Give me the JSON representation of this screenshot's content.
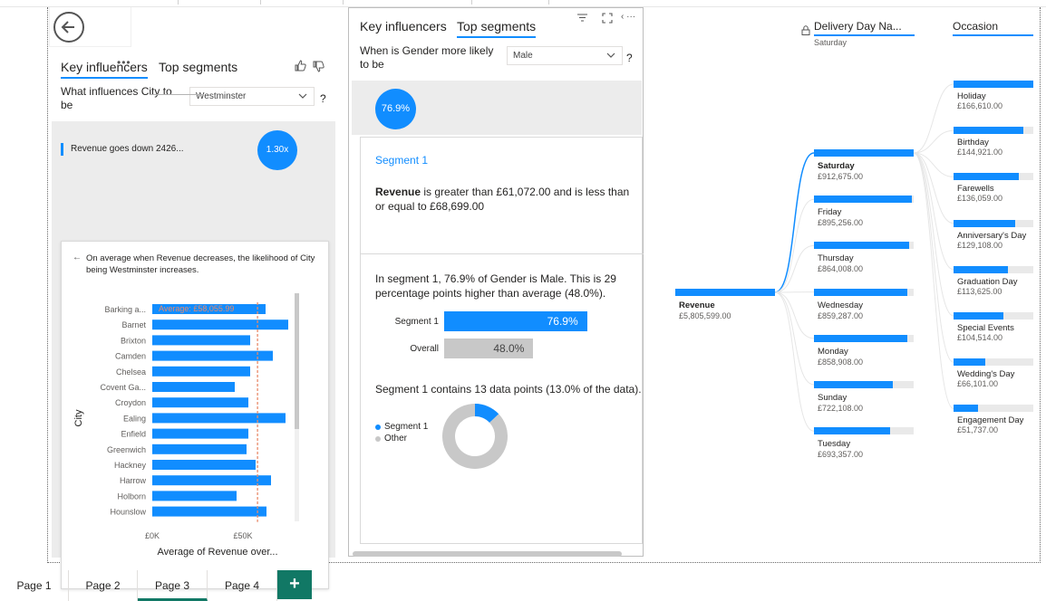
{
  "visual1": {
    "tabs": [
      "Key influencers",
      "Top segments"
    ],
    "question": "What influences City to be",
    "dropdown_value": "Westminster",
    "qmark": "?",
    "influencer_text": "Revenue goes down 2426...",
    "influencer_factor": "1.30x",
    "detail_text": "On average when Revenue decreases, the likelihood of City being Westminster increases.",
    "chart_data": {
      "type": "bar",
      "orientation": "horizontal",
      "categories": [
        "Barking a...",
        "Barnet",
        "Brixton",
        "Camden",
        "Chelsea",
        "Covent Ga...",
        "Croydon",
        "Ealing",
        "Enfield",
        "Greenwich",
        "Hackney",
        "Harrow",
        "Holborn",
        "Hounslow"
      ],
      "values": [
        62500,
        75000,
        54000,
        66500,
        54000,
        45500,
        53000,
        73500,
        53000,
        52000,
        57000,
        65500,
        46500,
        63000
      ],
      "average": 58055.99,
      "average_label": "Average: £58,055.99",
      "xlabel": "Average of Revenue over...",
      "ylabel": "City",
      "xticks": [
        "£0K",
        "£50K"
      ],
      "xtick_values": [
        0,
        50000
      ],
      "xlim": [
        0,
        90000
      ],
      "colors": {
        "bar": "#118dff",
        "average": "#e8896a"
      }
    }
  },
  "visual2": {
    "tabs": [
      "Key influencers",
      "Top segments"
    ],
    "question": "When is Gender more likely to be",
    "dropdown_value": "Male",
    "qmark": "?",
    "segment_bubble": "76.9%",
    "segment_title": "Segment 1",
    "segment_desc_bold": "Revenue",
    "segment_desc_rest": " is greater than £61,072.00 and is less than or equal to £68,699.00",
    "segment_stat": "In segment 1, 76.9% of Gender is Male. This is 29 percentage points higher than average (48.0%).",
    "compare_chart": {
      "type": "bar",
      "categories": [
        "Segment 1",
        "Overall"
      ],
      "values": [
        76.9,
        48.0
      ],
      "labels": [
        "76.9%",
        "48.0%"
      ],
      "colors": [
        "#118dff",
        "#c8c8c8"
      ]
    },
    "datapoints_text": "Segment 1 contains 13 data points (13.0% of the data).",
    "donut_chart": {
      "type": "pie",
      "categories": [
        "Segment 1",
        "Other"
      ],
      "values": [
        13.0,
        87.0
      ],
      "colors": [
        "#118dff",
        "#c8c8c8"
      ]
    }
  },
  "decomp_tree": {
    "headers": {
      "delivery_day": "Delivery Day Na...",
      "delivery_day_sub": "Saturday",
      "occasion": "Occasion"
    },
    "root": {
      "label": "Revenue",
      "value": "£5,805,599.00",
      "share": 1.0
    },
    "days": [
      {
        "label": "Saturday",
        "value": "£912,675.00",
        "share": 1.0,
        "selected": true
      },
      {
        "label": "Friday",
        "value": "£895,256.00",
        "share": 0.98
      },
      {
        "label": "Thursday",
        "value": "£864,008.00",
        "share": 0.95
      },
      {
        "label": "Wednesday",
        "value": "£859,287.00",
        "share": 0.94
      },
      {
        "label": "Monday",
        "value": "£858,908.00",
        "share": 0.94
      },
      {
        "label": "Sunday",
        "value": "£722,108.00",
        "share": 0.79
      },
      {
        "label": "Tuesday",
        "value": "£693,357.00",
        "share": 0.76
      }
    ],
    "occasions": [
      {
        "label": "Holiday",
        "value": "£166,610.00",
        "share": 1.0
      },
      {
        "label": "Birthday",
        "value": "£144,921.00",
        "share": 0.87
      },
      {
        "label": "Farewells",
        "value": "£136,059.00",
        "share": 0.82
      },
      {
        "label": "Anniversary's Day",
        "value": "£129,108.00",
        "share": 0.77
      },
      {
        "label": "Graduation Day",
        "value": "£113,625.00",
        "share": 0.68
      },
      {
        "label": "Special Events",
        "value": "£104,514.00",
        "share": 0.63
      },
      {
        "label": "Wedding's Day",
        "value": "£66,101.00",
        "share": 0.4
      },
      {
        "label": "Engagement Day",
        "value": "£51,737.00",
        "share": 0.31
      }
    ],
    "colors": {
      "bar": "#118dff",
      "track": "#e9e9e9"
    }
  },
  "page_tabs": [
    "Page 1",
    "Page 2",
    "Page 3",
    "Page 4"
  ],
  "active_page": "Page 3",
  "add_page": "+"
}
